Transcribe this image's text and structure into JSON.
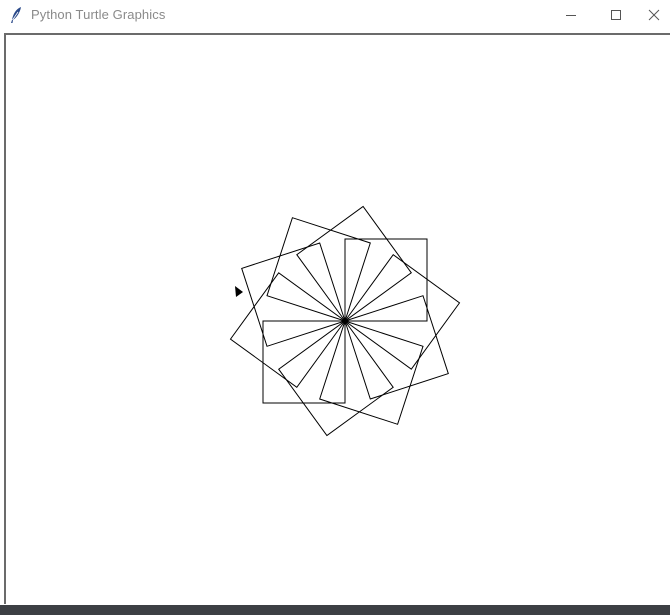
{
  "window": {
    "title": "Python Turtle Graphics",
    "icon": "feather-icon",
    "controls": [
      "minimize-icon",
      "maximize-icon",
      "close-icon"
    ]
  },
  "canvas": {
    "background": "#ffffff",
    "stroke_color": "#000000",
    "drawing": "rotated-square-spiral",
    "turtle_cursor": "arrow-icon"
  }
}
